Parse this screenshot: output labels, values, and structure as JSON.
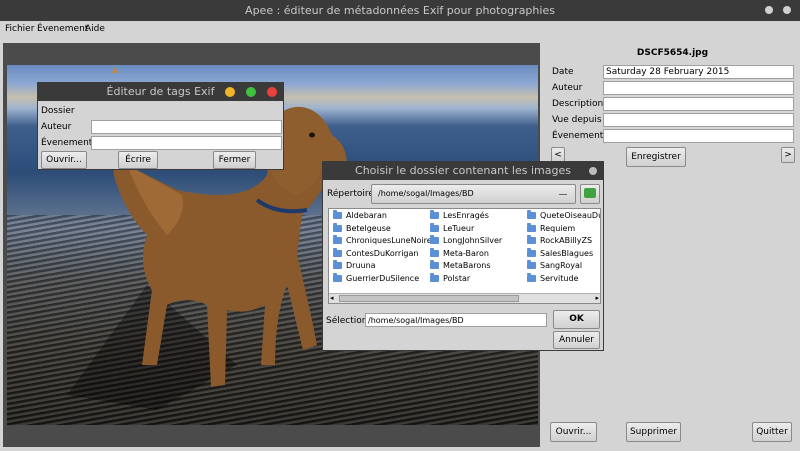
{
  "window": {
    "title": "Apee : éditeur de métadonnées Exif pour photographies"
  },
  "menu": [
    "Fichier",
    "Évenement",
    "Aide"
  ],
  "right_panel": {
    "filename": "DSCF5654.jpg",
    "fields": [
      {
        "label": "Date",
        "value": "Saturday 28 February 2015"
      },
      {
        "label": "Auteur",
        "value": ""
      },
      {
        "label": "Description",
        "value": ""
      },
      {
        "label": "Vue depuis",
        "value": ""
      },
      {
        "label": "Évenement",
        "value": ""
      }
    ],
    "prev": "<",
    "save": "Enregistrer",
    "next": ">",
    "open": "Ouvrir...",
    "delete": "Supprimer",
    "quit": "Quitter"
  },
  "exif_dialog": {
    "title": "Éditeur de tags Exif",
    "folder_label": "Dossier",
    "author_label": "Auteur",
    "event_label": "Évenement",
    "open": "Ouvrir...",
    "write": "Écrire",
    "close": "Fermer"
  },
  "folder_dialog": {
    "title": "Choisir le dossier contenant les images",
    "dir_label": "Répertoire:",
    "dir_value": "/home/sogal/Images/BD",
    "folders": [
      [
        "Aldebaran",
        "Betelgeuse",
        "ChroniquesLuneNoire",
        "ContesDuKorrigan",
        "Druuna",
        "GuerrierDuSilence"
      ],
      [
        "LesEnragés",
        "LeTueur",
        "LongJohnSilver",
        "Meta-Baron",
        "MetaBarons",
        "Polstar"
      ],
      [
        "QueteOiseauDuTe",
        "Requiem",
        "RockABillyZS",
        "SalesBlagues",
        "SangRoyal",
        "Servitude"
      ]
    ],
    "selection_label": "Sélection:",
    "selection_value": "/home/sogal/Images/BD",
    "ok": "OK",
    "cancel": "Annuler"
  },
  "colors": {
    "titlebar": "#3a3a3a",
    "yellow": "#f0b429",
    "green": "#3fc23f",
    "red": "#e8413a"
  }
}
